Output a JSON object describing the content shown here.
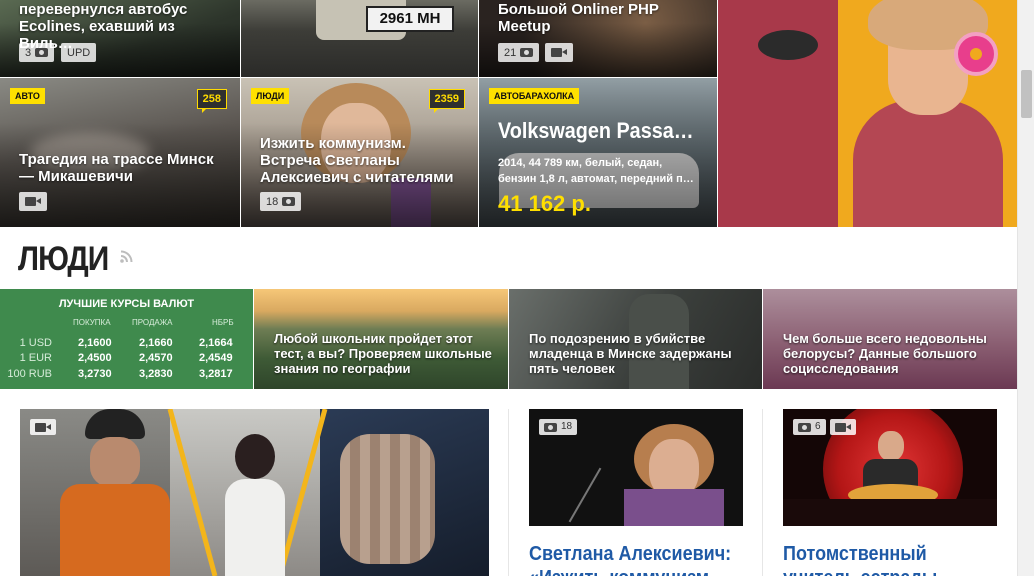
{
  "top_row": [
    {
      "title": "перевернулся автобус Ecolines, ехавший из Виль…",
      "photo_count": "3",
      "upd_label": "UPD"
    },
    {
      "plate": "2961 MH"
    },
    {
      "title": "Большой Onliner PHP Meetup",
      "photo_count": "21"
    }
  ],
  "second_row": [
    {
      "badge": "Авто",
      "comments": "258",
      "title": "Трагедия на трассе Минск — Микашевичи"
    },
    {
      "badge": "Люди",
      "comments": "2359",
      "title": "Изжить коммунизм. Встреча Светланы Алексиевич с читателями",
      "photo_count": "18"
    },
    {
      "badge": "Автобарахолка",
      "title": "Volkswagen Passa…",
      "desc": "2014, 44 789 км, белый, седан, бензин 1,8 л, автомат, передний п…",
      "price": "41 162 р."
    }
  ],
  "section": {
    "title": "ЛЮДИ"
  },
  "currency": {
    "header": "Лучшие курсы валют",
    "columns": [
      "покупка",
      "продажа",
      "НБРБ"
    ],
    "rows": [
      {
        "cur": "1 USD",
        "buy": "2,1600",
        "sell": "2,1660",
        "nbrb": "2,1664"
      },
      {
        "cur": "1 EUR",
        "buy": "2,4500",
        "sell": "2,4570",
        "nbrb": "2,4549"
      },
      {
        "cur": "100 RUB",
        "buy": "3,2730",
        "sell": "3,2830",
        "nbrb": "3,2817"
      }
    ]
  },
  "strip": [
    {
      "title": "Любой школьник пройдет этот тест, а вы? Проверяем школьные знания по географии"
    },
    {
      "title": "По подозрению в убийстве младенца в Минске задержаны пять человек"
    },
    {
      "title": "Чем больше всего недовольны белорусы? Данные большого социсследования"
    }
  ],
  "lower": [
    {
      "kind": "video"
    },
    {
      "photo_count": "18",
      "title": "Светлана Алексиевич:",
      "title2": "«Изжить коммунизм…"
    },
    {
      "photo_count": "6",
      "title": "Потомственный",
      "title2": "учитель эстрады…"
    }
  ],
  "colors": {
    "accent_yellow": "#ffe000",
    "fx_green": "#3f8a4d",
    "link_blue": "#1f5aa6"
  }
}
